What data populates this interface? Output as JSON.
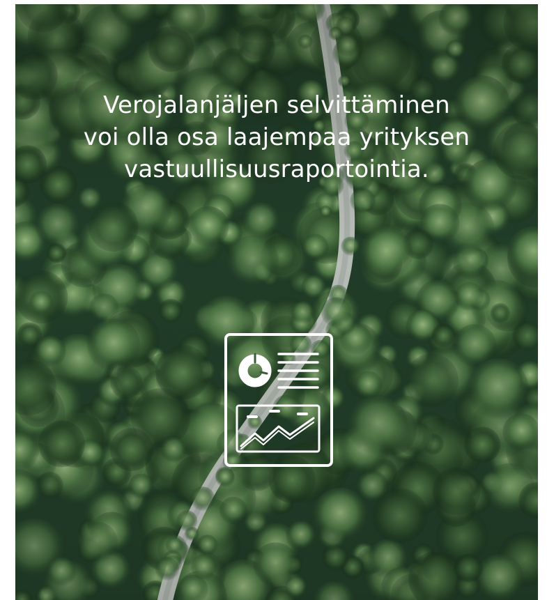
{
  "hero": {
    "headline_lines": [
      "Verojalanjäljen selvittäminen",
      "voi olla osa laajempaa yrityksen",
      "vastuullisuusraportointia."
    ],
    "background": "aerial-forest-road-photo",
    "icon": "report-document-icon"
  },
  "colors": {
    "text": "#ffffff",
    "icon_stroke": "#ffffff",
    "forest_dark": "#1f3a24",
    "forest_light": "#8fb07a",
    "road": "#c9cdc8"
  }
}
